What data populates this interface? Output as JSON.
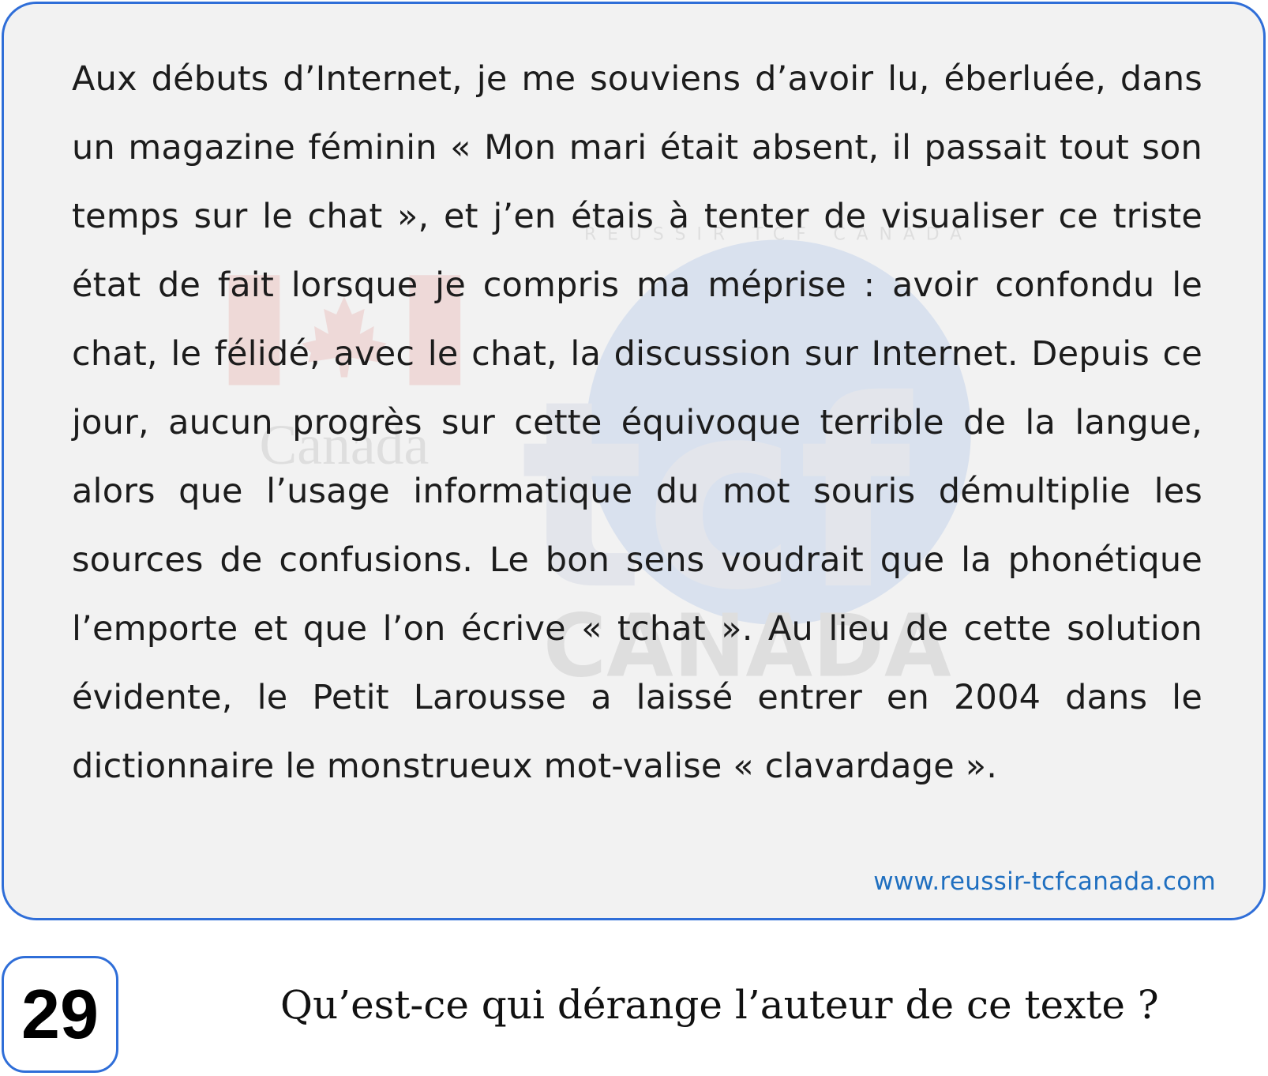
{
  "passage": {
    "text": "Aux débuts d’Internet, je me souviens d’avoir lu, éberluée, dans un magazine féminin « Mon mari était absent, il passait tout son temps sur le chat », et j’en étais à tenter de visualiser ce triste état de fait lorsque je compris ma méprise : avoir confondu le chat, le félidé, avec le chat, la discussion sur Internet. Depuis ce jour, aucun progrès sur cette équivoque terrible de la langue, alors que l’usage informatique du mot souris démultiplie les sources de confusions. Le bon sens voudrait que la phonétique l’emporte et que l’on écrive « tchat ». Au lieu de cette solution évidente, le Petit Larousse a laissé entrer en 2004 dans le dictionnaire le monstrueux mot-valise « clavardage ».",
    "source": "www.reussir-tcfcanada.com"
  },
  "watermark": {
    "flag_word": "Canada",
    "logo_letters": "tcf",
    "logo_word": "CANADA",
    "ring_text": "REUSSIR TCF CANADA"
  },
  "question": {
    "number": "29",
    "text": "Qu’est-ce qui dérange l’auteur de ce texte ?"
  },
  "colors": {
    "accent_border": "#2f6ed8",
    "link": "#1f6fc0",
    "card_background": "#f2f2f2"
  }
}
